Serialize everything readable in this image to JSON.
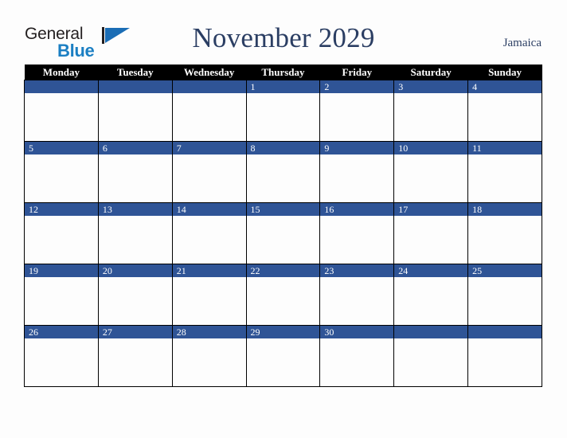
{
  "brand": {
    "name_part1": "General",
    "name_part2": "Blue",
    "mark": "triangle-flag-icon"
  },
  "header": {
    "title": "November 2029",
    "region": "Jamaica"
  },
  "colors": {
    "date_bar": "#2f5496",
    "header_row": "#000000",
    "title_text": "#2b3e63",
    "logo_blue": "#1b7fc3",
    "page_background": "#fdfdfd",
    "grid_line": "#000000"
  },
  "calendar": {
    "month": "November",
    "year": "2029",
    "weekday_headers": [
      "Monday",
      "Tuesday",
      "Wednesday",
      "Thursday",
      "Friday",
      "Saturday",
      "Sunday"
    ],
    "weeks": [
      [
        "",
        "",
        "",
        "1",
        "2",
        "3",
        "4"
      ],
      [
        "5",
        "6",
        "7",
        "8",
        "9",
        "10",
        "11"
      ],
      [
        "12",
        "13",
        "14",
        "15",
        "16",
        "17",
        "18"
      ],
      [
        "19",
        "20",
        "21",
        "22",
        "23",
        "24",
        "25"
      ],
      [
        "26",
        "27",
        "28",
        "29",
        "30",
        "",
        ""
      ]
    ]
  }
}
